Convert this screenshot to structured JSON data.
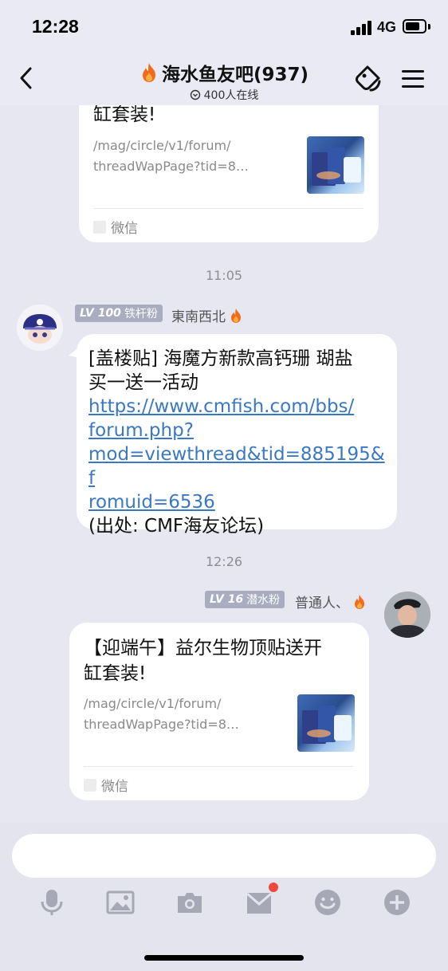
{
  "status_bar": {
    "time": "12:28",
    "network": "4G"
  },
  "header": {
    "title": "海水鱼友吧(937)",
    "online": "400人在线"
  },
  "messages": [
    {
      "type": "card",
      "title_tail": "缸套装!",
      "link": [
        "/mag/circle/v1/forum/",
        "threadWapPage?tid=8…"
      ],
      "source": "微信"
    },
    {
      "type": "time",
      "text": "11:05"
    },
    {
      "type": "text",
      "level": "LV 100",
      "level_title": "铁杆粉",
      "nickname": "東南西北",
      "text_line1": "[盖楼贴] 海魔方新款高钙珊 瑚盐",
      "text_line2": "买一送一活动",
      "url_lines": [
        "https://www.cmfish.com/bbs/",
        "forum.php?",
        "mod=viewthread&tid=885195&f",
        "romuid=6536"
      ],
      "source_line": "(出处: CMF海友论坛)"
    },
    {
      "type": "time",
      "text": "12:26"
    },
    {
      "type": "card",
      "level": "LV 16",
      "level_title": "潜水粉",
      "nickname": "普通人、",
      "title_lines": [
        "【迎端午】益尔生物顶贴送开",
        "缸套装!"
      ],
      "link": [
        "/mag/circle/v1/forum/",
        "threadWapPage?tid=8…"
      ],
      "source": "微信"
    }
  ],
  "toolbar": {
    "icons": [
      "microphone-icon",
      "image-icon",
      "camera-icon",
      "gift-icon",
      "emoji-icon",
      "plus-icon"
    ],
    "accent": "#f0493a"
  },
  "colors": {
    "background": "#e6e7f0",
    "link": "#3b78c4",
    "badge": "#a9adbf"
  }
}
